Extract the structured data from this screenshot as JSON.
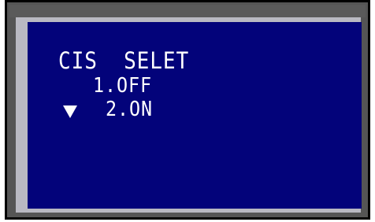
{
  "menu": {
    "title": "CIS  SELET",
    "options": [
      {
        "label": "1.OFF"
      },
      {
        "label": "2.ON"
      }
    ],
    "cursor_icon": "down-triangle-icon",
    "selected_index": 2
  },
  "colors": {
    "screen": "#03037a",
    "text": "#ffffff",
    "frame": "#555555"
  }
}
